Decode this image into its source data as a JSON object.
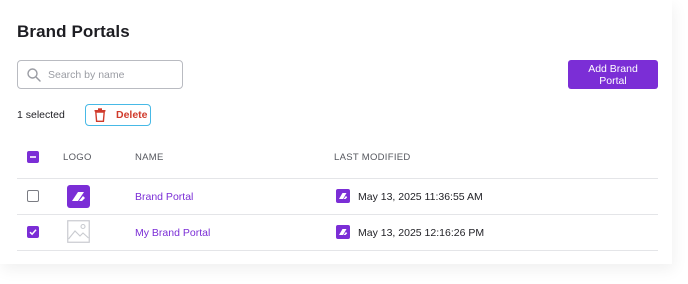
{
  "page": {
    "title": "Brand Portals"
  },
  "search": {
    "placeholder": "Search by name",
    "value": ""
  },
  "toolbar": {
    "add_label": "Add Brand Portal",
    "selected_text": "1 selected",
    "delete_label": "Delete"
  },
  "table": {
    "headers": {
      "logo": "LOGO",
      "name": "NAME",
      "modified": "LAST MODIFIED"
    },
    "rows": [
      {
        "name": "Brand Portal",
        "modified": "May 13, 2025 11:36:55 AM",
        "checked": false,
        "logo": "brand-portal-logo-icon"
      },
      {
        "name": "My Brand Portal",
        "modified": "May 13, 2025 12:16:26 PM",
        "checked": true,
        "logo": "image-placeholder-icon"
      }
    ]
  },
  "colors": {
    "accent": "#7b2ed6",
    "danger": "#d03b2c",
    "focus": "#47b9e6"
  }
}
